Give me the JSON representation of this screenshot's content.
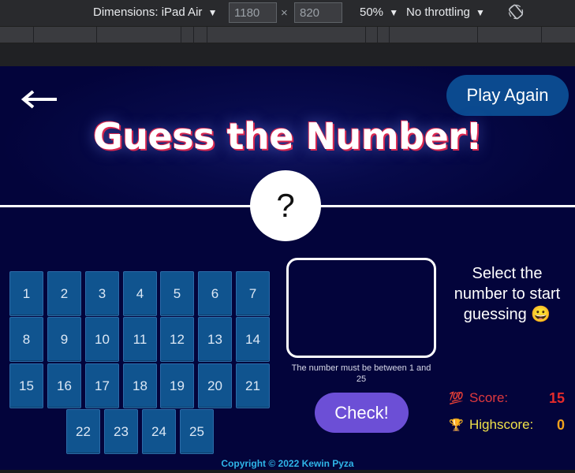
{
  "devtools": {
    "dimensions_label": "Dimensions: iPad Air",
    "width_value": "1180",
    "times_symbol": "×",
    "height_value": "820",
    "zoom_label": "50%",
    "throttling_label": "No throttling",
    "dropdown_arrow": "▼",
    "rotate_icon": "rotate-icon"
  },
  "game": {
    "play_again_label": "Play Again",
    "title": "Guess the Number!",
    "secret_display": "?",
    "numbers": [
      "1",
      "2",
      "3",
      "4",
      "5",
      "6",
      "7",
      "8",
      "9",
      "10",
      "11",
      "12",
      "13",
      "14",
      "15",
      "16",
      "17",
      "18",
      "19",
      "20",
      "21",
      "22",
      "23",
      "24",
      "25"
    ],
    "guess_value": "",
    "hint": "The number must be between 1 and 25",
    "check_label": "Check!",
    "message": "Select the number to start guessing 😀",
    "score_icon": "💯",
    "score_label": "Score:",
    "score_value": "15",
    "highscore_icon": "🏆",
    "highscore_label": "Highscore:",
    "highscore_value": "0",
    "copyright": "Copyright © 2022 Kewin Pyza"
  },
  "colors": {
    "background": "#03043b",
    "play_again_bg": "#0b4a8f",
    "number_button_bg": "#10548f",
    "check_bg": "#6c4fd6",
    "score_label": "#e0393e",
    "score_value": "#e52b2b",
    "highscore_label": "#f0e14a",
    "highscore_value": "#f1a21c",
    "copyright": "#2fb5e8"
  }
}
